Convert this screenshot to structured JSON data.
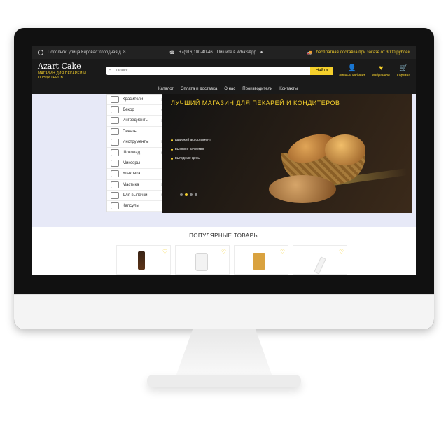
{
  "topbar": {
    "address": "Подольск, улица Кирова/Огородная д. 8",
    "phone": "+7(916)100-40-46",
    "messengers": "Пишите в WhatsApp",
    "delivery": "бесплатная доставка при заказе от 3000 рублей"
  },
  "header": {
    "logo_text": "Azart Cake",
    "logo_tagline": "МАГАЗИН ДЛЯ ПЕКАРЕЙ И КОНДИТЕРОВ",
    "search_placeholder": "Поиск",
    "search_button": "Найти",
    "actions": [
      {
        "label": "Личный кабинет",
        "icon": "user-icon"
      },
      {
        "label": "Избранное",
        "icon": "heart-icon"
      },
      {
        "label": "Корзина",
        "icon": "cart-icon"
      }
    ]
  },
  "nav": [
    "Каталог",
    "Оплата и доставка",
    "О нас",
    "Производители",
    "Контакты"
  ],
  "sidebar": [
    {
      "label": "Красители",
      "has_arrow": true
    },
    {
      "label": "Декор",
      "has_arrow": true
    },
    {
      "label": "Ингредиенты",
      "has_arrow": true
    },
    {
      "label": "Печать",
      "has_arrow": false
    },
    {
      "label": "Инструменты",
      "has_arrow": true
    },
    {
      "label": "Шоколад",
      "has_arrow": true
    },
    {
      "label": "Миксеры",
      "has_arrow": false
    },
    {
      "label": "Упаковка",
      "has_arrow": false
    },
    {
      "label": "Мастика",
      "has_arrow": true
    },
    {
      "label": "Для выпечки",
      "has_arrow": true
    },
    {
      "label": "Капсулы",
      "has_arrow": false
    }
  ],
  "banner": {
    "title": "ЛУЧШИЙ МАГАЗИН  ДЛЯ ПЕКАРЕЙ И КОНДИТЕРОВ",
    "bullets": [
      "широкий ассортимент",
      "высокое качество",
      "выгодные цены"
    ],
    "slides": 4,
    "active_slide": 2
  },
  "popular": {
    "title": "ПОПУЛЯРНЫЕ ТОВАРЫ"
  },
  "colors": {
    "accent": "#f5d02c",
    "dark": "#1a1a1a",
    "content_bg": "#e7e9f7"
  }
}
